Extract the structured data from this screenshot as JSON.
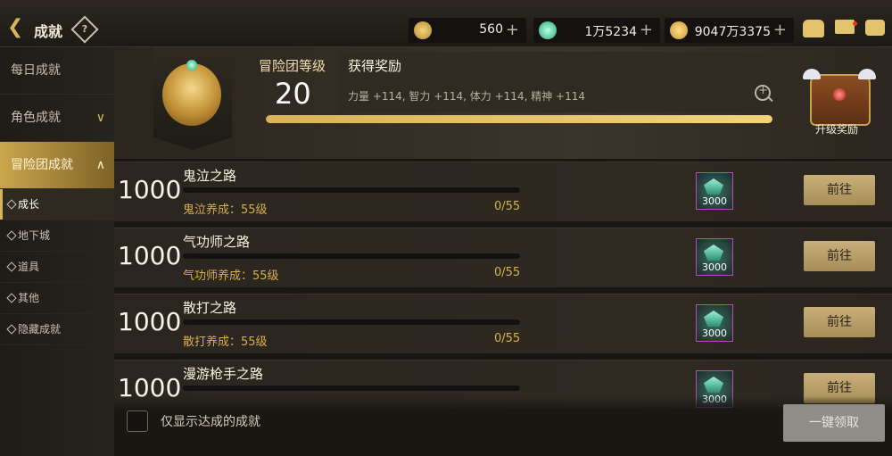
{
  "topbar": {
    "title": "成就",
    "back_icon": "back-arrow-icon",
    "help_icon": "question-icon",
    "currencies": [
      {
        "icon": "gold-c-coin-icon",
        "value": "560",
        "plus": "+"
      },
      {
        "icon": "green-gem-icon",
        "value": "1万5234",
        "plus": "+"
      },
      {
        "icon": "gold-coin-icon",
        "value": "9047万3375",
        "plus": "+"
      }
    ],
    "icons": [
      "bag-icon",
      "mail-icon",
      "chat-icon"
    ]
  },
  "sidebar": {
    "main": [
      {
        "label": "每日成就"
      },
      {
        "label": "角色成就",
        "chevron": "∨"
      },
      {
        "label": "冒险团成就",
        "chevron": "∧"
      }
    ],
    "sub": [
      {
        "label": "成长"
      },
      {
        "label": "地下城"
      },
      {
        "label": "道具"
      },
      {
        "label": "其他"
      },
      {
        "label": "隐藏成就"
      }
    ]
  },
  "header": {
    "level_label": "冒险团等级",
    "level": "20",
    "reward_title": "获得奖励",
    "reward_desc": "力量 +114, 智力 +114, 体力 +114, 精神 +114",
    "progress_fraction": 1.0,
    "chest_label": "升级奖励"
  },
  "achievements": [
    {
      "points": "1000",
      "name": "鬼泣之路",
      "requirement": "鬼泣养成：55级",
      "progress": "0/55",
      "reward_count": "3000",
      "button": "前往"
    },
    {
      "points": "1000",
      "name": "气功师之路",
      "requirement": "气功师养成：55级",
      "progress": "0/55",
      "reward_count": "3000",
      "button": "前往"
    },
    {
      "points": "1000",
      "name": "散打之路",
      "requirement": "散打养成：55级",
      "progress": "0/55",
      "reward_count": "3000",
      "button": "前往"
    },
    {
      "points": "1000",
      "name": "漫游枪手之路",
      "requirement": "",
      "progress": "",
      "reward_count": "3000",
      "button": "前往"
    }
  ],
  "footer": {
    "checkbox_label": "仅显示达成的成就",
    "claim_all": "一键领取"
  },
  "colors": {
    "accent_gold": "#d9b35c",
    "progress_text": "#d8b04a",
    "disabled_button": "#8f8d88"
  }
}
